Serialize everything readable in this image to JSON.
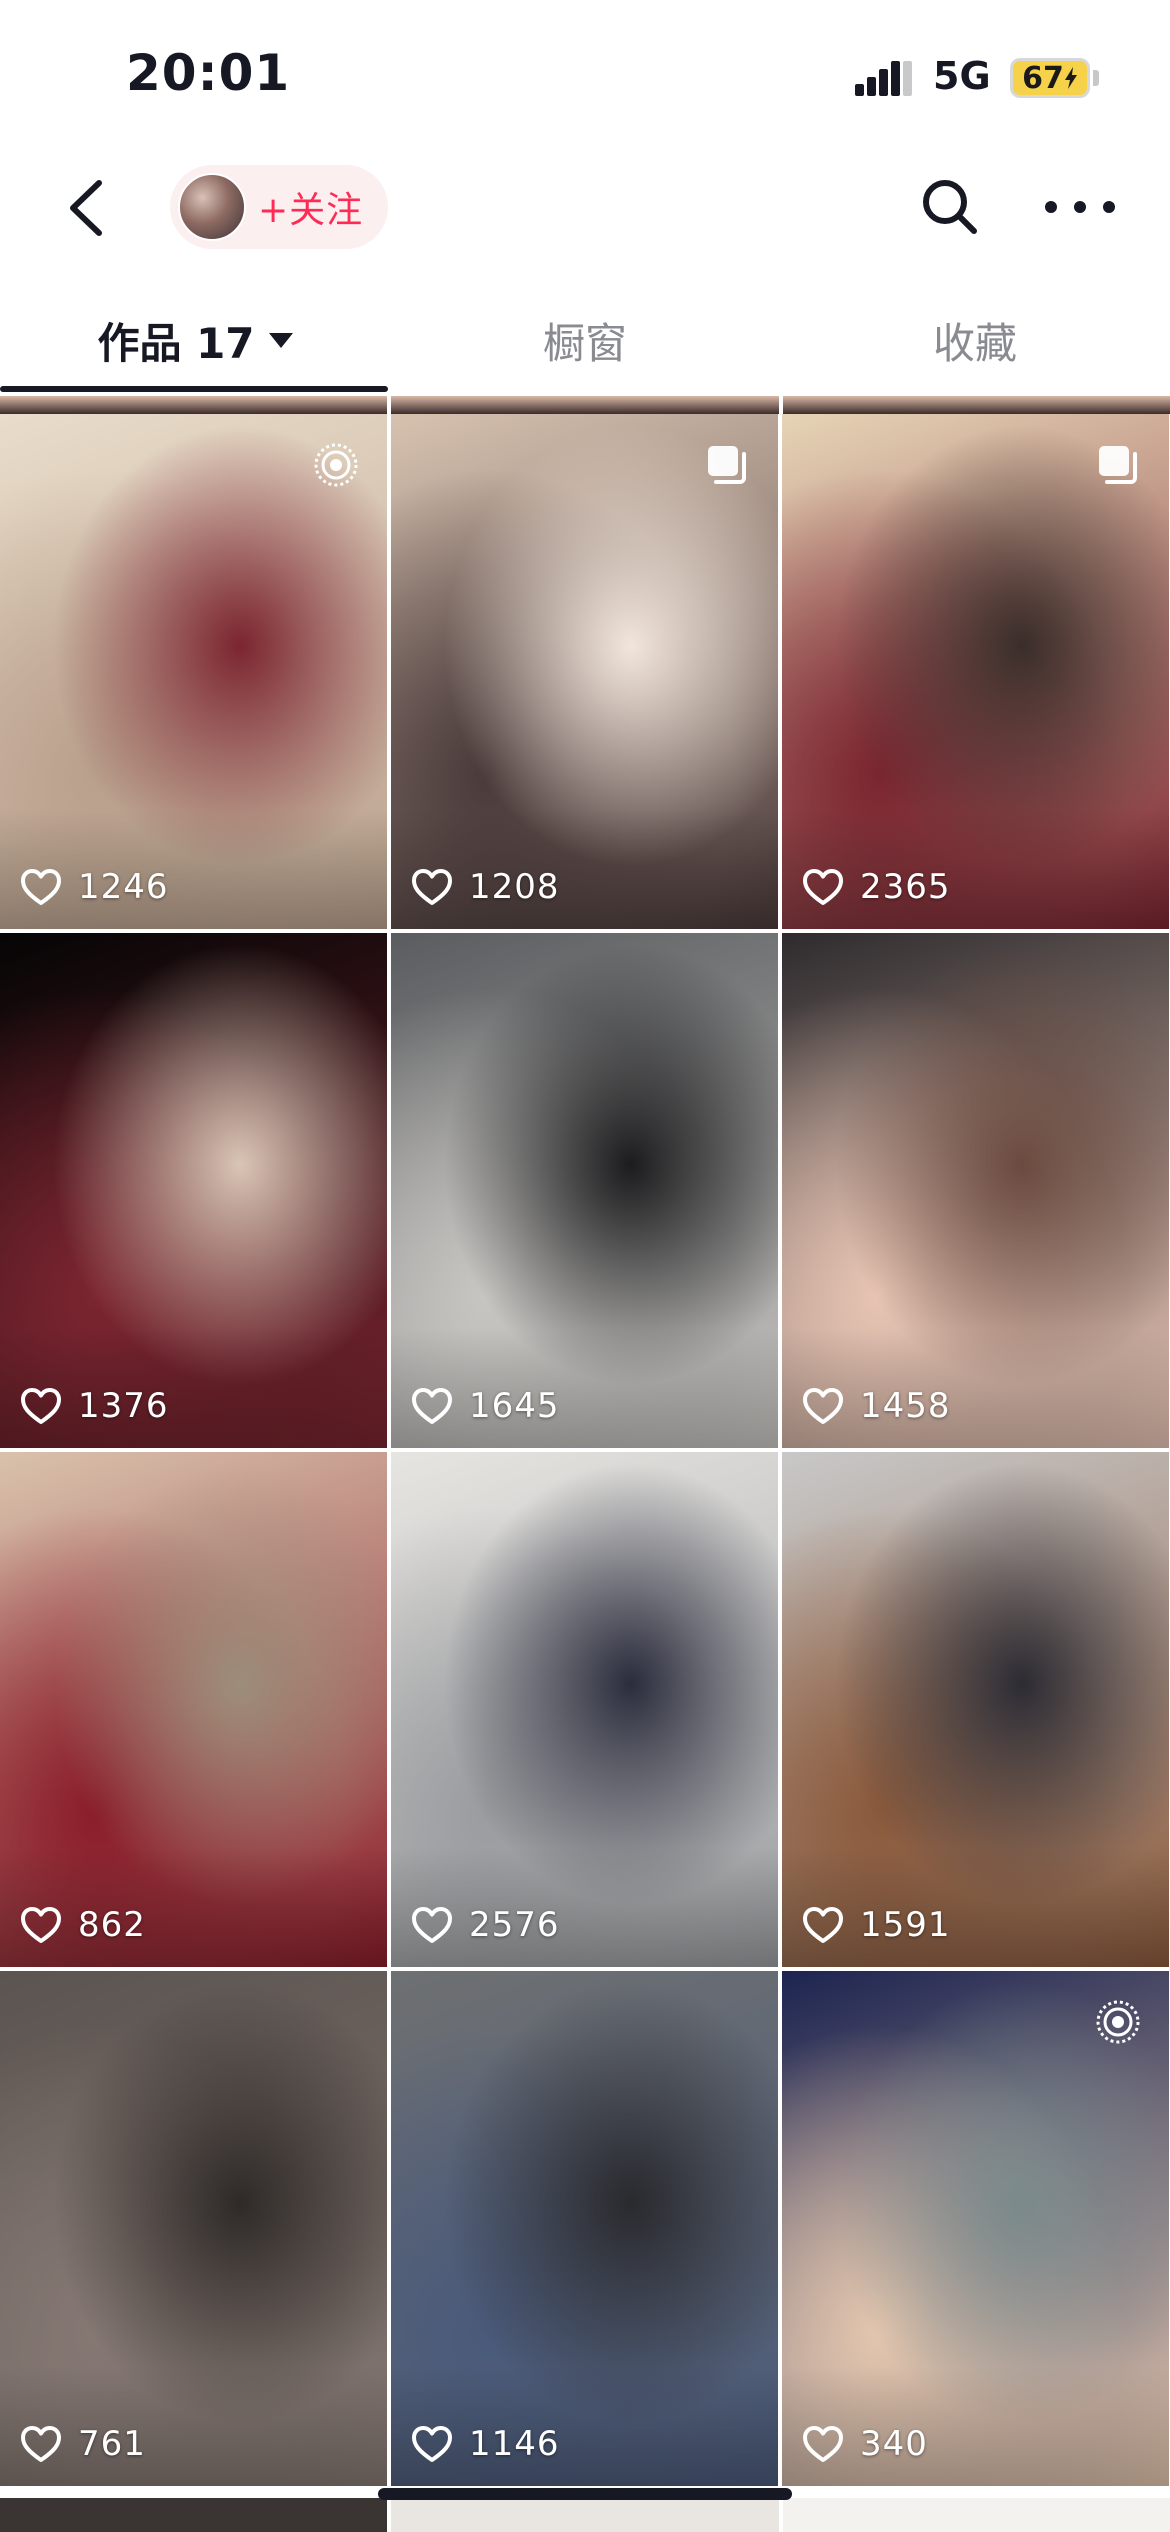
{
  "status_bar": {
    "time": "20:01",
    "network": "5G",
    "battery": "67"
  },
  "nav": {
    "follow_label": "+关注",
    "icons": [
      "chevron-left-icon",
      "avatar",
      "search-icon",
      "more-icon"
    ]
  },
  "tabs": [
    {
      "label": "作品 17",
      "active": true
    },
    {
      "label": "橱窗",
      "active": false
    },
    {
      "label": "收藏",
      "active": false
    }
  ],
  "videos": [
    {
      "likes": "1246",
      "badge": "live-icon",
      "palette": [
        "#e9dcca",
        "#b9a08c",
        "#7b2530"
      ]
    },
    {
      "likes": "1208",
      "badge": "multi-image-icon",
      "palette": [
        "#d7c2b0",
        "#4a3a3a",
        "#f2e6dc"
      ]
    },
    {
      "likes": "2365",
      "badge": "multi-image-icon",
      "palette": [
        "#e6d4b6",
        "#7b2530",
        "#3a2e2a"
      ]
    },
    {
      "likes": "1376",
      "badge": "",
      "palette": [
        "#050505",
        "#7b2530",
        "#d9c5b5"
      ]
    },
    {
      "likes": "1645",
      "badge": "",
      "palette": [
        "#5a5c5f",
        "#c8c6c2",
        "#1c1c1e"
      ]
    },
    {
      "likes": "1458",
      "badge": "",
      "palette": [
        "#2e2b2e",
        "#e8c5b4",
        "#6b4b40"
      ]
    },
    {
      "likes": "862",
      "badge": "",
      "palette": [
        "#d9c2ac",
        "#8a1d2a",
        "#9d8d7a"
      ]
    },
    {
      "likes": "2576",
      "badge": "",
      "palette": [
        "#e7e5e1",
        "#9a9c9f",
        "#2b2d3d"
      ]
    },
    {
      "likes": "1591",
      "badge": "",
      "palette": [
        "#c8c8c8",
        "#8b5a3c",
        "#2c2c34"
      ]
    },
    {
      "likes": "761",
      "badge": "",
      "palette": [
        "#5b5450",
        "#857873",
        "#2f2a28"
      ]
    },
    {
      "likes": "1146",
      "badge": "",
      "palette": [
        "#6e7072",
        "#4a5a7a",
        "#2a2a2e"
      ]
    },
    {
      "likes": "340",
      "badge": "live-icon",
      "palette": [
        "#1c2450",
        "#e3c6ae",
        "#7b8a8c"
      ]
    }
  ]
}
